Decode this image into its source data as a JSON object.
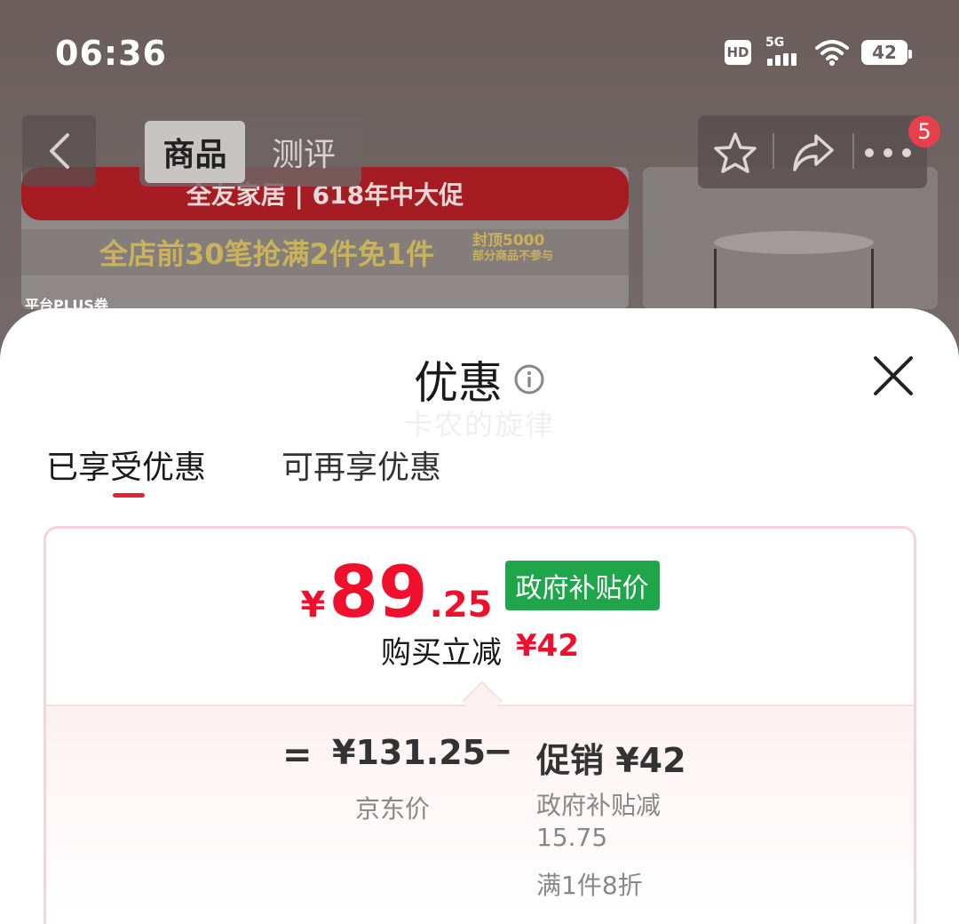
{
  "status_bar": {
    "time": "06:36",
    "hd": "HD",
    "network": "5G",
    "battery": "42"
  },
  "nav": {
    "tabs": [
      "商品",
      "测评"
    ],
    "cart_badge": "5"
  },
  "banner": {
    "title": "全友家居 | 618年中大促",
    "promo": "全店前30笔抢满2件免1件",
    "sub_line1": "封顶5000",
    "sub_line2": "部分商品不参与",
    "plus_tag": "平台PLUS券"
  },
  "sheet": {
    "title": "优惠",
    "watermark": "卡农的旋律",
    "tabs": [
      "已享受优惠",
      "可再享优惠"
    ],
    "price": {
      "yen": "¥",
      "integer": "89",
      "decimal": ".25",
      "tag": "政府补贴价"
    },
    "save": {
      "label": "购买立减",
      "value": "¥42"
    },
    "breakdown": {
      "equals": "=",
      "base_price": "¥131.25",
      "base_label": "京东价",
      "minus": "−",
      "promo_title": "促销 ¥42",
      "promo_detail_line1": "政府补贴减",
      "promo_detail_line2": "15.75",
      "promo_extra": "满1件8折"
    }
  },
  "colors": {
    "accent_red": "#f0102e",
    "tag_green": "#1fa54a",
    "card_border": "#f8d2d9"
  }
}
